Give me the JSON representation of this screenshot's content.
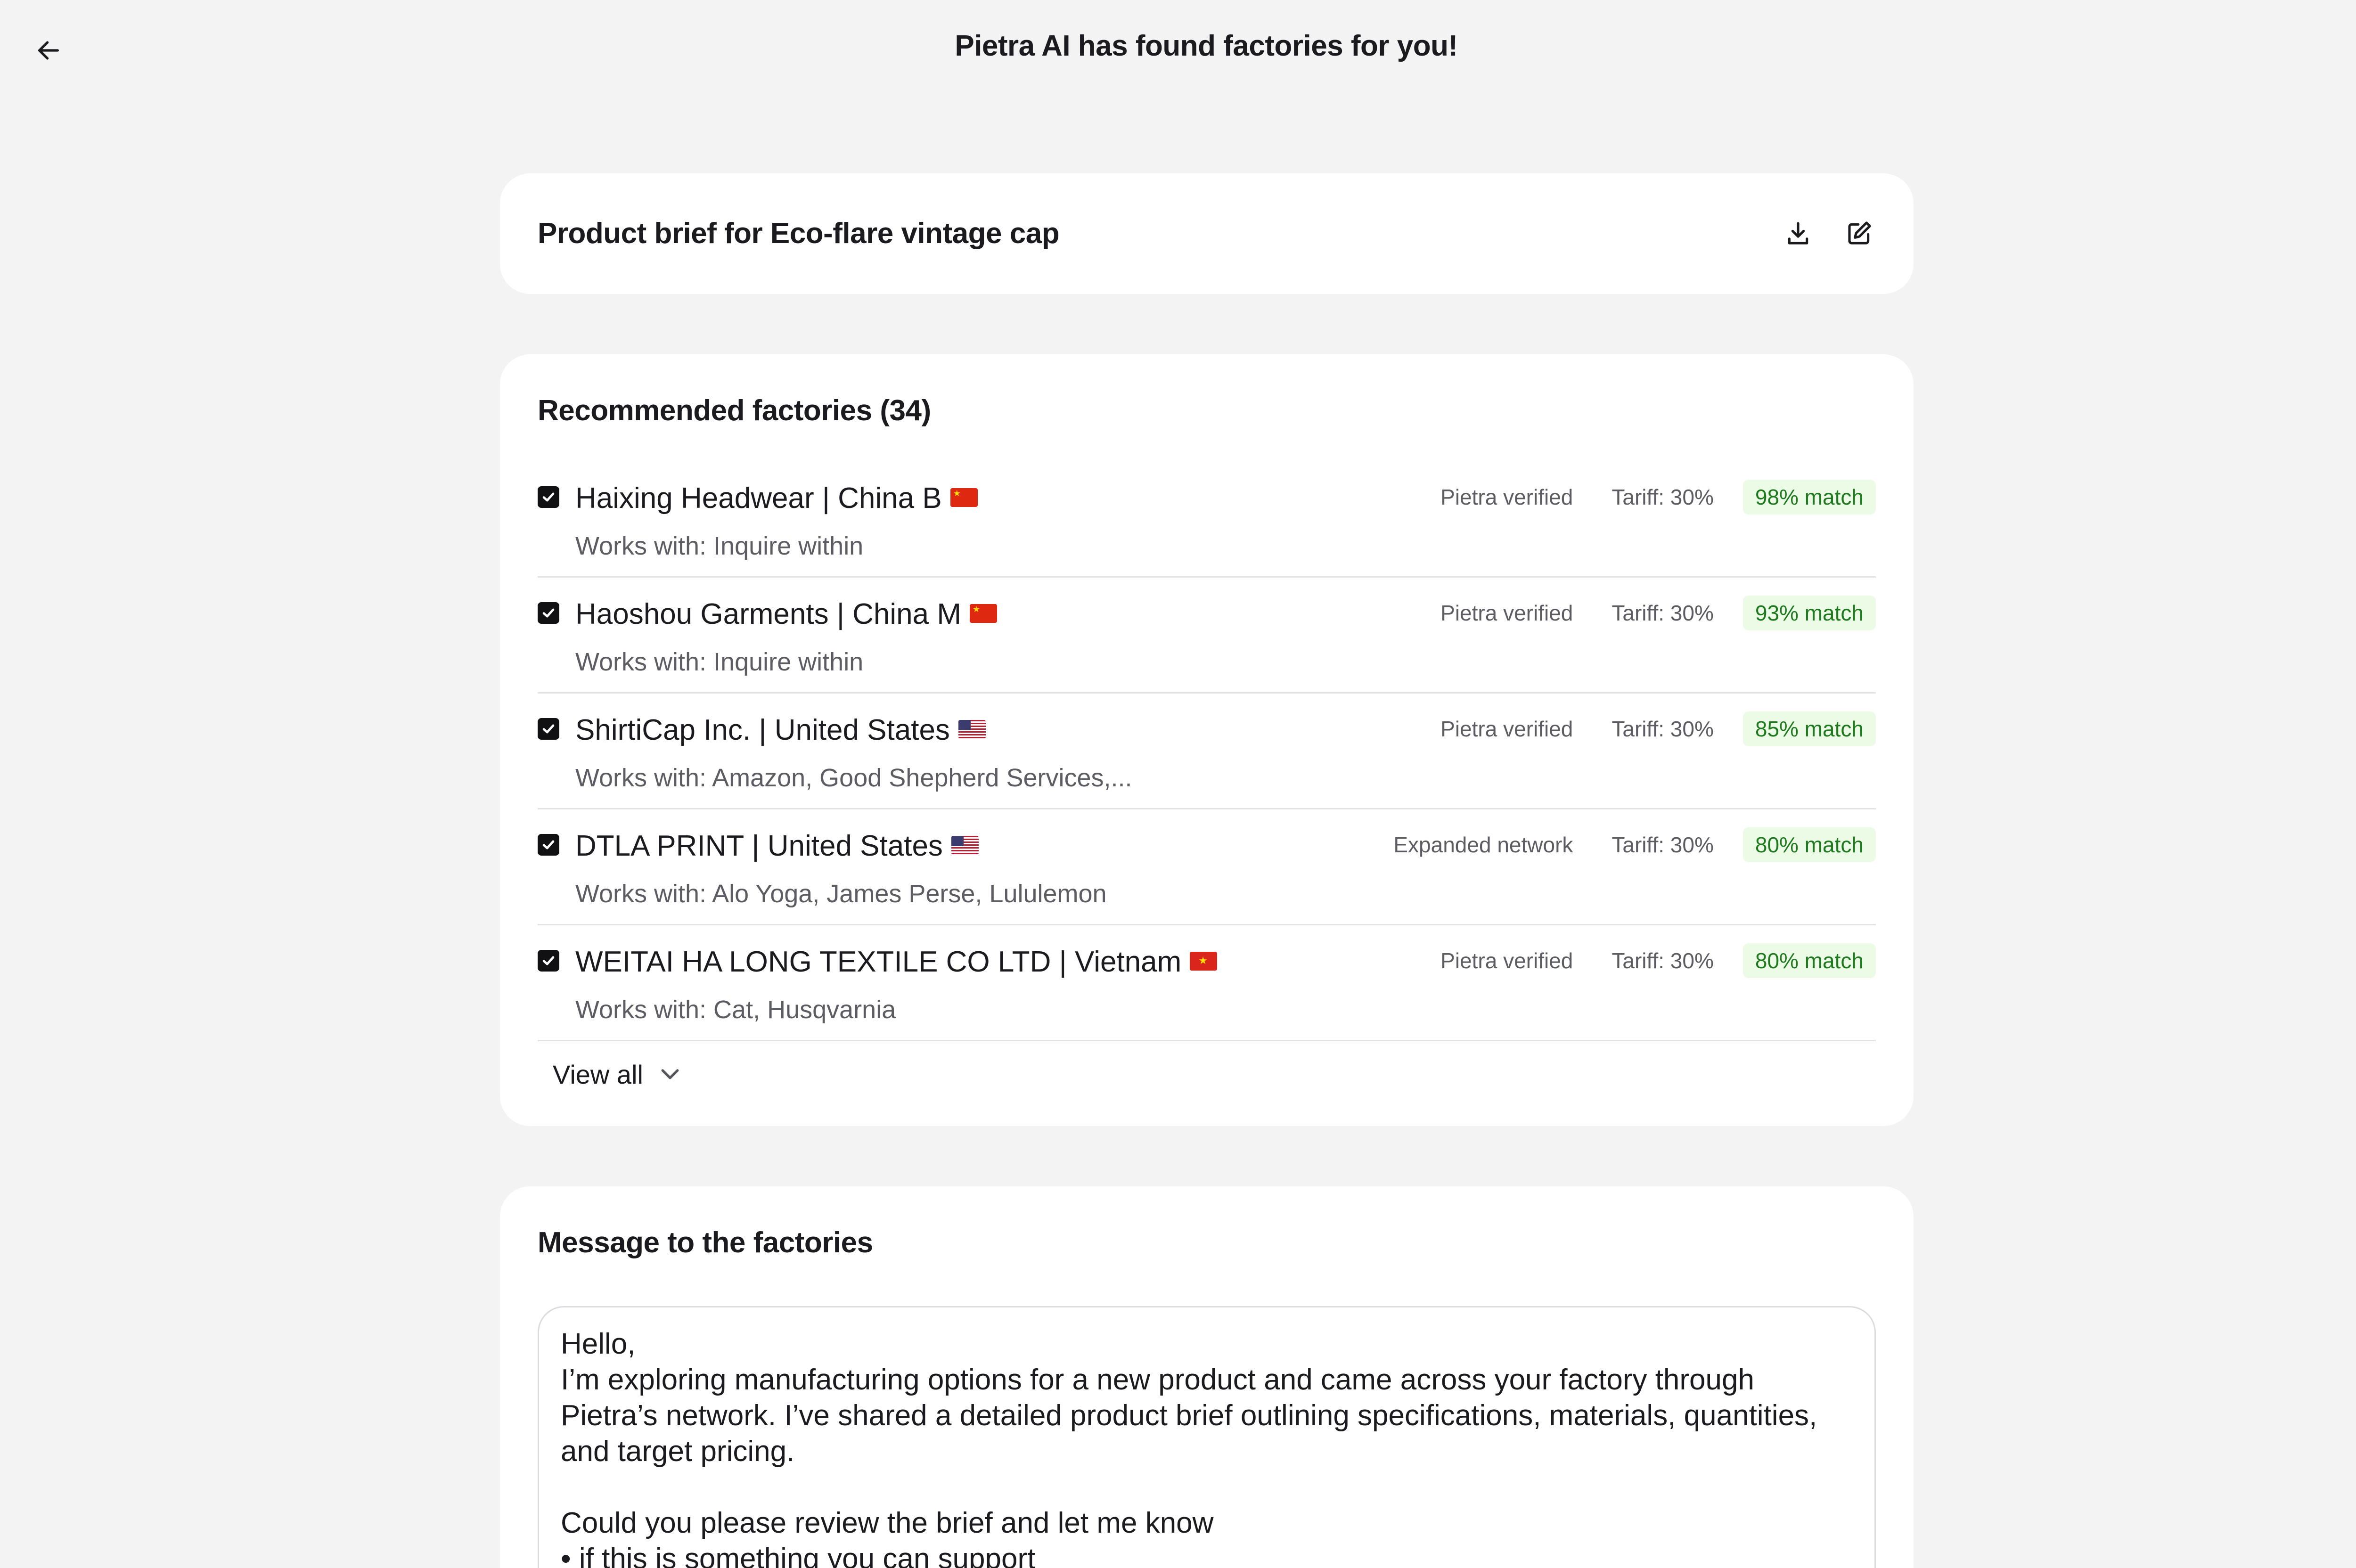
{
  "header": {
    "title": "Pietra AI has found factories for you!"
  },
  "brief": {
    "title": "Product brief for Eco-flare vintage cap"
  },
  "factories": {
    "title": "Recommended factories (34)",
    "view_all_label": "View all",
    "items": [
      {
        "name": "Haixing Headwear | China B",
        "flag": "cn",
        "works_with": "Works with: Inquire within",
        "status": "Pietra verified",
        "tariff": "Tariff: 30%",
        "match": "98% match",
        "checked": true
      },
      {
        "name": "Haoshou Garments | China M",
        "flag": "cn",
        "works_with": "Works with: Inquire within",
        "status": "Pietra verified",
        "tariff": "Tariff: 30%",
        "match": "93% match",
        "checked": true
      },
      {
        "name": "ShirtiCap Inc. | United States",
        "flag": "us",
        "works_with": "Works with: Amazon, Good Shepherd Services,...",
        "status": "Pietra verified",
        "tariff": "Tariff: 30%",
        "match": "85% match",
        "checked": true
      },
      {
        "name": "DTLA PRINT | United States",
        "flag": "us",
        "works_with": "Works with: Alo Yoga, James Perse, Lululemon",
        "status": "Expanded network",
        "tariff": "Tariff: 30%",
        "match": "80% match",
        "checked": true
      },
      {
        "name": "WEITAI HA LONG TEXTILE CO LTD | Vietnam",
        "flag": "vn",
        "works_with": "Works with: Cat, Husqvarnia",
        "status": "Pietra verified",
        "tariff": "Tariff: 30%",
        "match": "80% match",
        "checked": true
      }
    ]
  },
  "message": {
    "title": "Message to the factories",
    "body": "Hello,\nI’m exploring manufacturing options for a new product and came across your factory through Pietra’s network. I’ve shared a detailed product brief outlining specifications, materials, quantities, and target pricing.\n\nCould you please review the brief and let me know\n• if this is something you can support"
  },
  "colors": {
    "background": "#f3f3f4",
    "card": "#ffffff",
    "match_badge_bg": "#ecfbe6",
    "match_badge_text": "#1f7a1f"
  }
}
